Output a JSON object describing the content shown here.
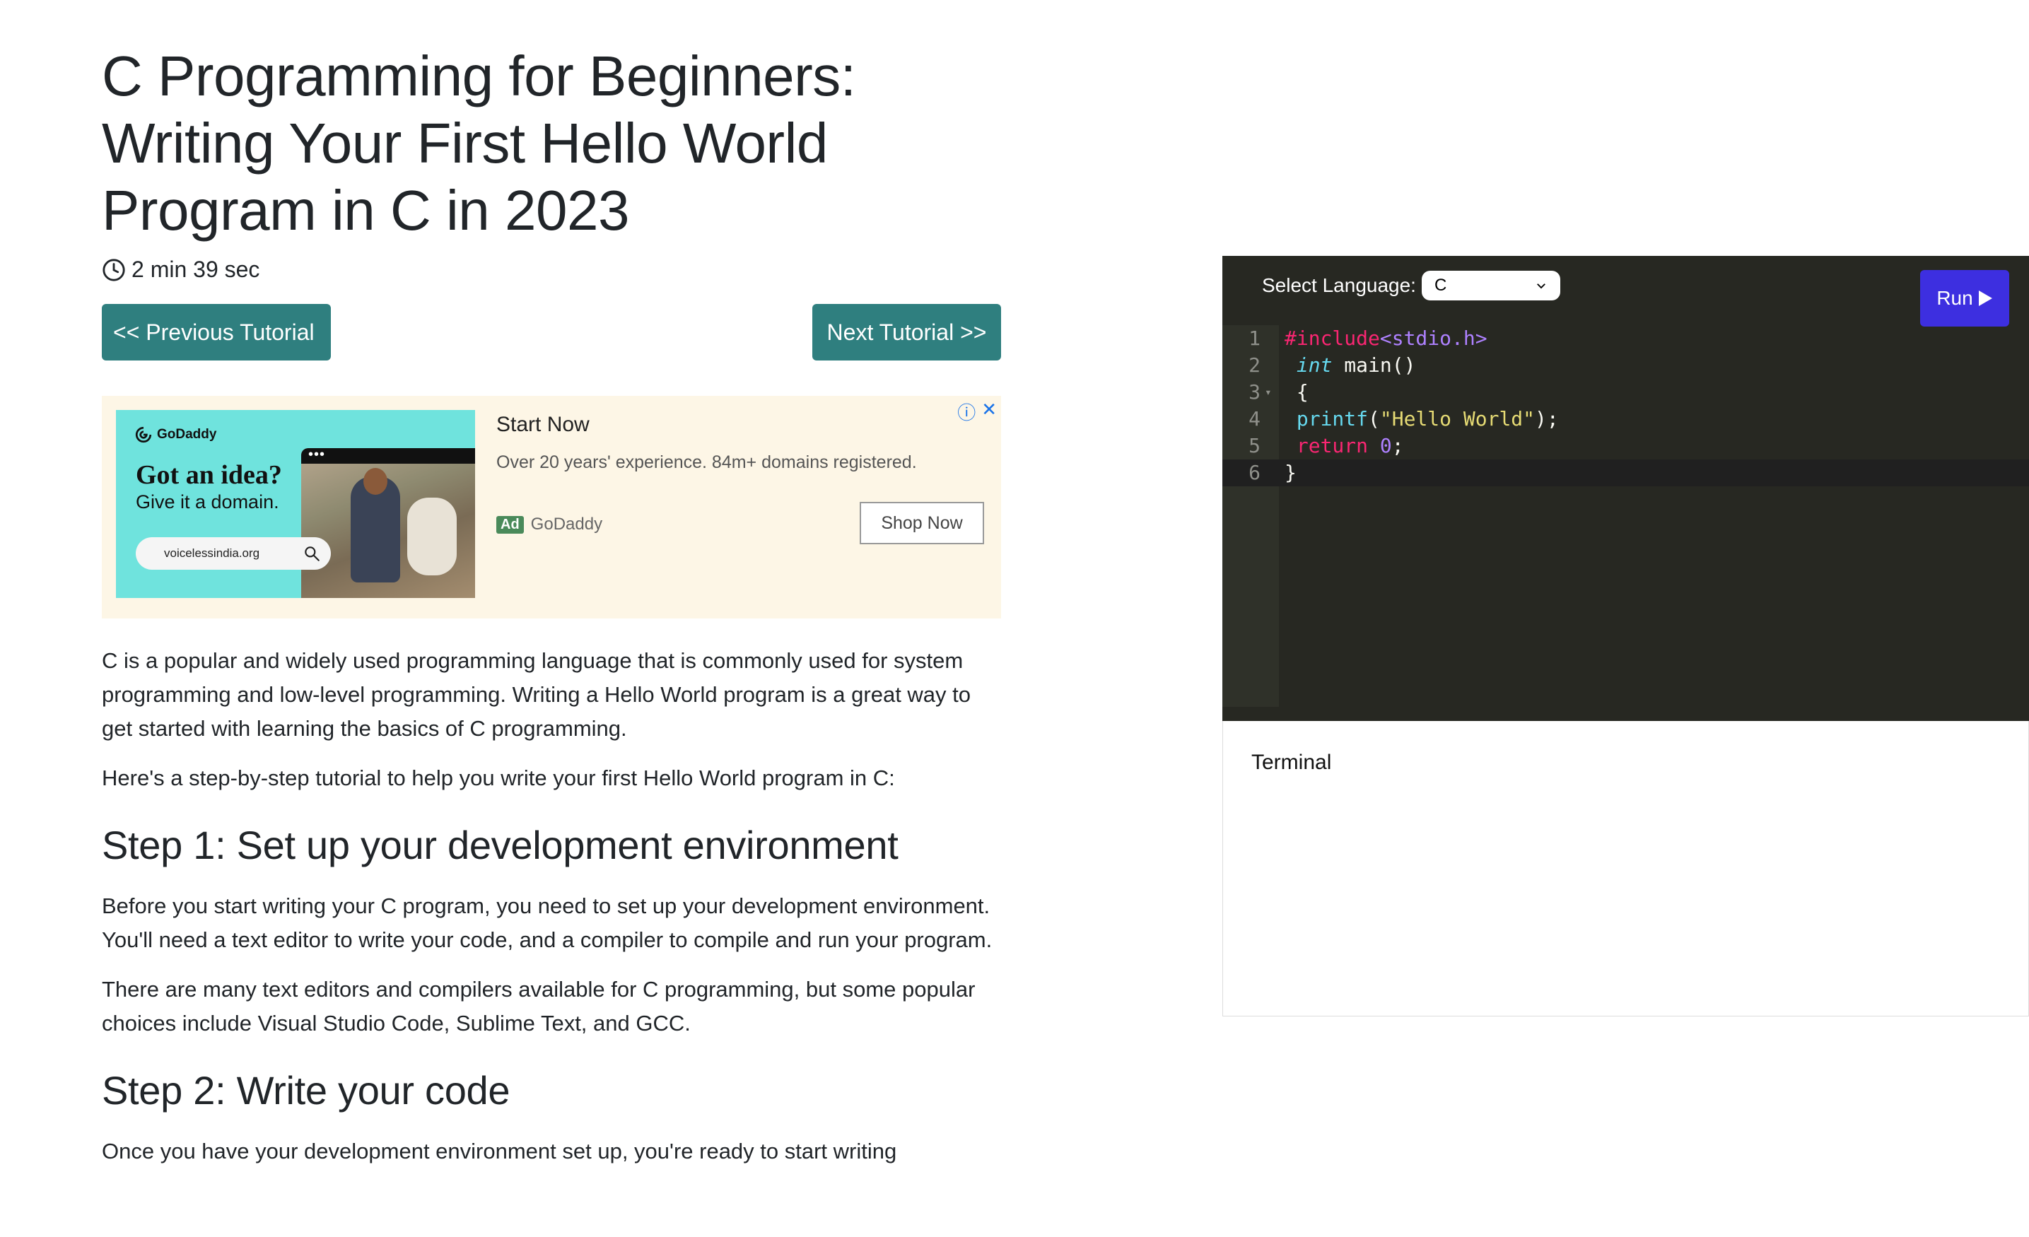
{
  "article": {
    "title": "C Programming for Beginners: Writing Your First Hello World Program in C in 2023",
    "read_time": "2 min 39 sec",
    "prev_label": "<< Previous Tutorial",
    "next_label": "Next Tutorial >>",
    "paragraphs_intro": [
      "C is a popular and widely used programming language that is commonly used for system programming and low-level programming. Writing a Hello World program is a great way to get started with learning the basics of C programming.",
      "Here's a step-by-step tutorial to help you write your first Hello World program in C:"
    ],
    "step1_heading": "Step 1: Set up your development environment",
    "step1_paragraphs": [
      "Before you start writing your C program, you need to set up your development environment. You'll need a text editor to write your code, and a compiler to compile and run your program.",
      "There are many text editors and compilers available for C programming, but some popular choices include Visual Studio Code, Sublime Text, and GCC."
    ],
    "step2_heading": "Step 2: Write your code",
    "step2_partial": "Once you have your development environment set up, you're ready to start writing"
  },
  "ad": {
    "brand_logo": "GoDaddy",
    "image_headline": "Got an idea?",
    "image_subline": "Give it a domain.",
    "image_search_text": "voicelessindia.org",
    "title": "Start Now",
    "description": "Over 20 years' experience. 84m+ domains registered.",
    "badge": "Ad",
    "source": "GoDaddy",
    "cta_label": "Shop Now",
    "info_icon": "ⓘ",
    "close_icon": "✕"
  },
  "editor": {
    "language_label": "Select Language:",
    "language_value": "C",
    "run_label": "Run",
    "lines": [
      {
        "num": "1",
        "text": "#include<stdio.h>"
      },
      {
        "num": "2",
        "text": " int main()"
      },
      {
        "num": "3",
        "text": " {"
      },
      {
        "num": "4",
        "text": " printf(\"Hello World\");"
      },
      {
        "num": "5",
        "text": " return 0;"
      },
      {
        "num": "6",
        "text": "}"
      }
    ],
    "active_line": 6
  },
  "terminal": {
    "label": "Terminal"
  },
  "colors": {
    "nav_button": "#2f7f7f",
    "run_button": "#3d2fe0",
    "editor_bg": "#272822",
    "ad_bg": "#fdf6e6"
  }
}
